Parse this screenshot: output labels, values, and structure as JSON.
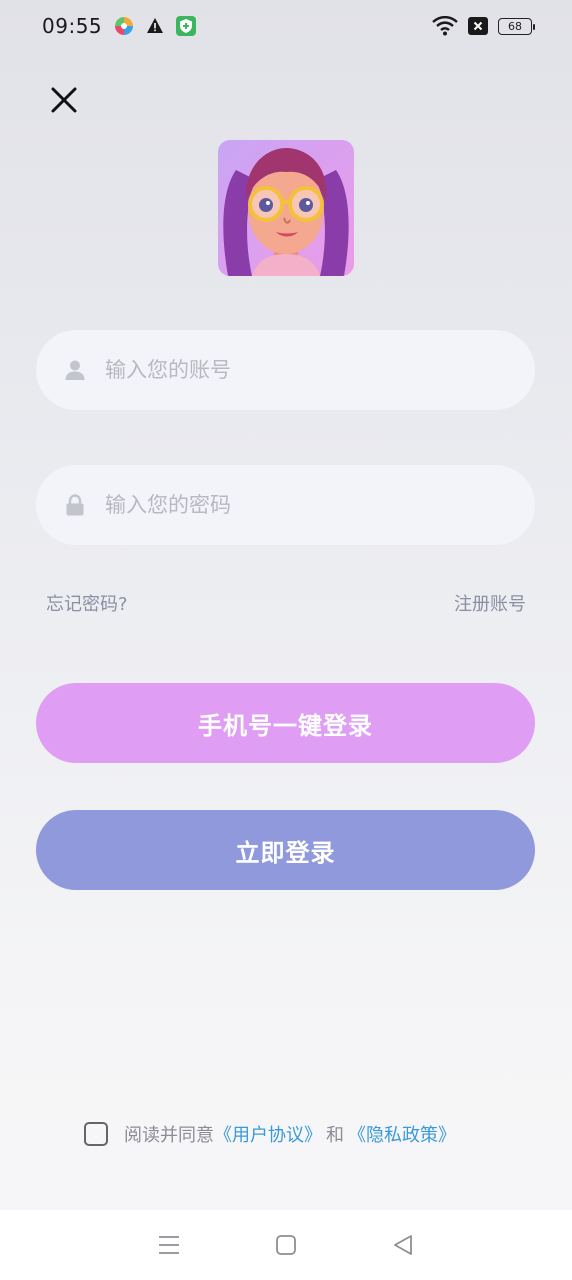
{
  "status_bar": {
    "time": "09:55",
    "battery": "68",
    "icons": [
      "pinwheel-app-icon",
      "warning-icon",
      "shield-app-icon",
      "wifi-icon",
      "close-box-icon",
      "battery-icon"
    ]
  },
  "header": {
    "close_icon": "close-icon"
  },
  "avatar": {
    "icon": "cartoon-girl-avatar"
  },
  "form": {
    "account_placeholder": "输入您的账号",
    "password_placeholder": "输入您的密码",
    "account_icon": "user-icon",
    "password_icon": "lock-icon"
  },
  "links": {
    "forgot": "忘记密码?",
    "register": "注册账号"
  },
  "buttons": {
    "phone_login": "手机号一键登录",
    "login": "立即登录"
  },
  "agreement": {
    "prefix": "阅读并同意",
    "user_agreement": "《用户协议》",
    "and": "和",
    "privacy_policy": "《隐私政策》",
    "checked": false
  },
  "navbar": {
    "icons": [
      "menu-icon",
      "home-icon",
      "back-icon"
    ]
  },
  "colors": {
    "phone_button": "#df9ef4",
    "login_button": "#8f99dc",
    "link": "#3a9ad9"
  }
}
